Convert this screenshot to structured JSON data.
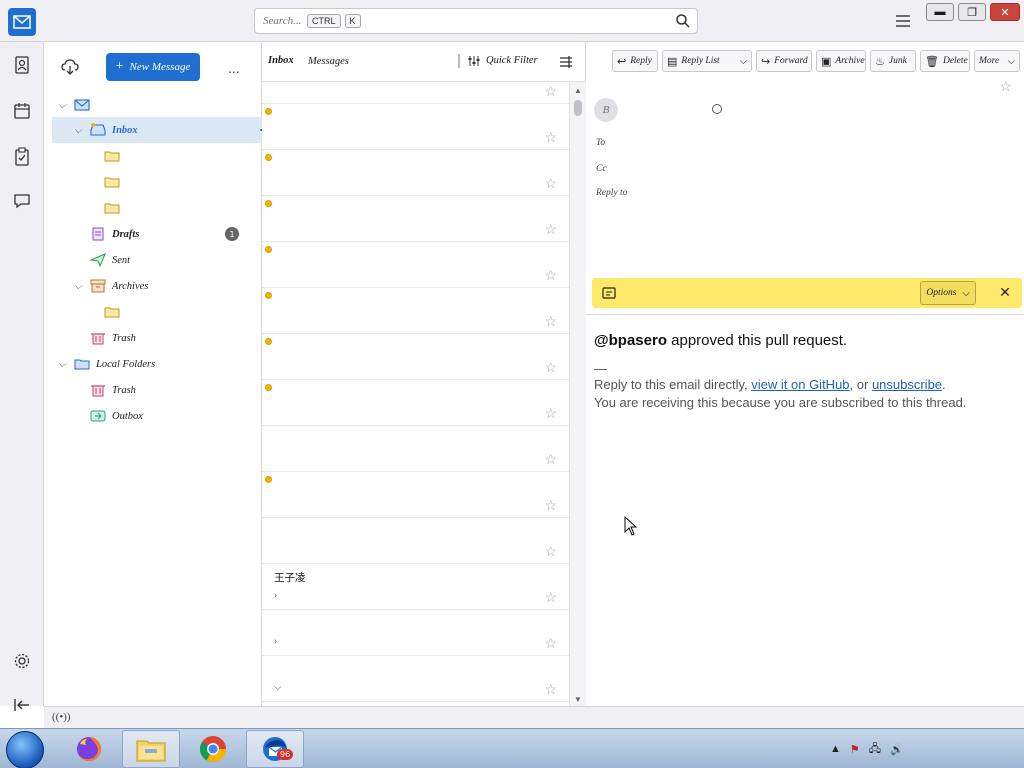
{
  "titlebar": {
    "search_placeholder": "Search...",
    "shortcut_key_1": "CTRL",
    "shortcut_key_2": "K",
    "window_controls": [
      "minimize",
      "maximize",
      "close"
    ]
  },
  "spaces": [
    "mail-icon",
    "address-book-icon",
    "calendar-icon",
    "tasks-icon",
    "chat-icon",
    "settings-icon",
    "collapse-icon"
  ],
  "folder_pane": {
    "new_message_label": "New Message",
    "more_label": "...",
    "folders": [
      {
        "label": "",
        "kind": "account"
      },
      {
        "label": "Inbox",
        "kind": "inbox",
        "selected": true,
        "unread_badge": ""
      },
      {
        "label": "",
        "kind": "folder"
      },
      {
        "label": "",
        "kind": "folder"
      },
      {
        "label": "",
        "kind": "folder"
      },
      {
        "label": "Drafts",
        "kind": "drafts",
        "badge": "1"
      },
      {
        "label": "Sent",
        "kind": "sent"
      },
      {
        "label": "Archives",
        "kind": "archive"
      },
      {
        "label": "",
        "kind": "folder"
      },
      {
        "label": "Trash",
        "kind": "trash"
      },
      {
        "label": "Local Folders",
        "kind": "local"
      },
      {
        "label": "Trash",
        "kind": "trash"
      },
      {
        "label": "Outbox",
        "kind": "outbox"
      }
    ]
  },
  "message_list": {
    "title": "Inbox",
    "count_label": "Messages",
    "quick_filter_label": "Quick Filter",
    "messages": [
      {
        "sender": "",
        "subject": "",
        "date": "",
        "unread": false
      },
      {
        "sender": "",
        "subject": "",
        "date": "",
        "unread": true
      },
      {
        "sender": "",
        "subject": "",
        "date": "",
        "unread": true
      },
      {
        "sender": "",
        "subject": "",
        "date": "",
        "unread": true
      },
      {
        "sender": "",
        "subject": "",
        "date": "",
        "unread": true
      },
      {
        "sender": "",
        "subject": "",
        "date": "",
        "unread": true
      },
      {
        "sender": "",
        "subject": "",
        "date": "",
        "unread": true
      },
      {
        "sender": "",
        "subject": "",
        "date": "",
        "unread": true
      },
      {
        "sender": "",
        "subject": "",
        "date": "",
        "unread": false
      },
      {
        "sender": "",
        "subject": "",
        "date": "",
        "unread": true
      },
      {
        "sender": "",
        "subject": "",
        "date": "",
        "unread": false
      },
      {
        "sender": "王子凌",
        "subject": "",
        "date": "",
        "unread": false,
        "thread": "closed"
      },
      {
        "sender": "",
        "subject": "",
        "date": "",
        "unread": false,
        "thread": "closed"
      },
      {
        "sender": "",
        "subject": "",
        "date": "",
        "unread": false,
        "thread": "open"
      }
    ]
  },
  "reader": {
    "toolbar": [
      "Reply",
      "Reply List",
      "Forward",
      "Archive",
      "Junk",
      "Delete",
      "More"
    ],
    "from_name": "",
    "from_email": "",
    "to_label": "To",
    "to_value": "",
    "to_time": "",
    "cc_label": "Cc",
    "cc_value": "",
    "reply_to_label": "Reply to",
    "reply_to_value": "",
    "subject": "",
    "remote_bar_text": "",
    "remote_options_label": "Options",
    "body_user": "@bpasero",
    "body_text": " approved this pull request.",
    "body_dash": "—",
    "footer_pre": "Reply to this email directly, ",
    "footer_link_1": "view it on GitHub",
    "footer_mid": ", or ",
    "footer_link_2": "unsubscribe",
    "footer_post": ".",
    "footer_line_2": "You are receiving this because you are subscribed to this thread."
  },
  "statusbar": {
    "text": ""
  },
  "taskbar": {
    "apps": [
      "firefox-icon",
      "file-explorer-icon",
      "chrome-icon",
      "thunderbird-icon"
    ],
    "thunderbird_badge": "96",
    "clock_time": "",
    "clock_date": ""
  },
  "colors": {
    "accent": "#1f6fd1",
    "selected_row": "#dde8f5",
    "remote_bar": "#ffe96b",
    "unread_dot": "#f0b400"
  }
}
